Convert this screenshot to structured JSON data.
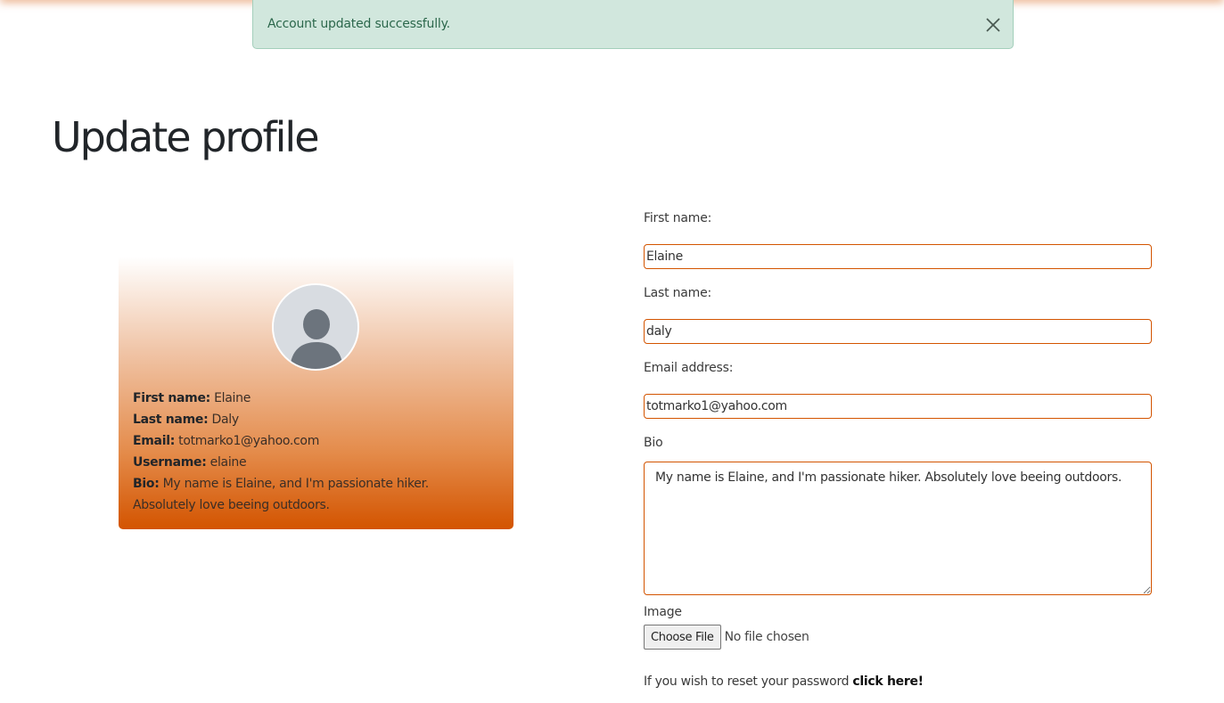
{
  "alert": {
    "message": "Account updated successfully.",
    "close_icon": "close-icon",
    "color": "#d1e7dd"
  },
  "page": {
    "title": "Update profile"
  },
  "profile_card": {
    "avatar_icon": "user-silhouette-icon",
    "first_name_label": "First name:",
    "first_name_value": "Elaine",
    "last_name_label": "Last name:",
    "last_name_value": "Daly",
    "email_label": "Email:",
    "email_value": "totmarko1@yahoo.com",
    "username_label": "Username:",
    "username_value": "elaine",
    "bio_label": "Bio:",
    "bio_value": "My name is Elaine, and I'm passionate hiker. Absolutely love beeing outdoors.",
    "gradient_color": "#d35400"
  },
  "form": {
    "first_name_label": "First name:",
    "first_name_value": "Elaine",
    "last_name_label": "Last name:",
    "last_name_value": "daly",
    "email_label": "Email address:",
    "email_value": "totmarko1@yahoo.com",
    "bio_label": "Bio",
    "bio_value": "My name is Elaine, and I'm passionate hiker. Absolutely love beeing outdoors.",
    "image_label": "Image",
    "file_button_label": "Choose File",
    "file_status": "No file chosen",
    "input_border_color": "#d35400"
  },
  "reset": {
    "text": "If you wish to reset your password ",
    "link_text": "click here!"
  }
}
